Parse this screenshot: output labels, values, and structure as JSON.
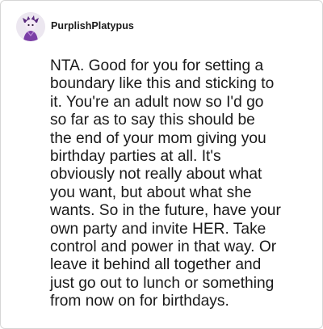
{
  "post": {
    "username": "PurplishPlatypus",
    "avatar_icon": "purple-character-avatar-icon",
    "comment_text": "NTA. Good for you for setting a\nboundary like this and sticking to\nit. You're an adult now so I'd go\nso far as to say this should be\nthe end of your mom giving you\nbirthday parties at all. It's\nobviously not really about what\nyou want, but about what she\nwants. So in the future, have your\nown party and invite HER. Take\ncontrol and power in that way. Or\nleave it behind all together and\njust go out to lunch or something\nfrom now on for birthdays."
  },
  "colors": {
    "avatar_background": "#ece7f0",
    "avatar_character": "#7b3fa6",
    "text": "#1a1a1a",
    "border": "#d6d6d6"
  }
}
